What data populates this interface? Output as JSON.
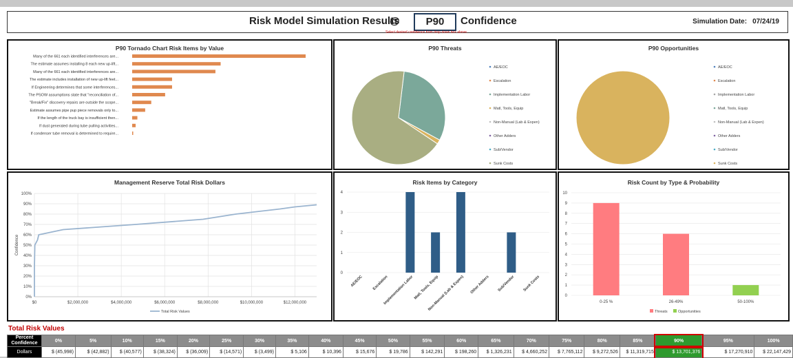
{
  "header": {
    "title": "Risk Model Simulation Results",
    "at": "@",
    "confidence_level": "P90",
    "confidence_label": "Confidence",
    "sim_date_label": "Simulation Date:",
    "sim_date": "07/24/19",
    "hint": "Select desired confidence from drop down box above."
  },
  "colors": {
    "tornado": "#e0894f",
    "teal": "#7ba89a",
    "olive": "#a9ae82",
    "gold": "#d9b35e",
    "line": "#9ab4cf",
    "bar_blue": "#2f5d87",
    "threats": "#ff7c80",
    "opportunities": "#92d050",
    "highlight": "#2e9a2e"
  },
  "chart_data": [
    {
      "type": "bar",
      "orientation": "horizontal",
      "title": "P90 Tornado Chart Risk Items by Value",
      "categories": [
        "Many of the 661 each identified interferences are...",
        "The estimate assumes installing 8 each new up-lift...",
        "Many of the 661 each identified interferences are...",
        "The estimate includes installation of new up-lift feet...",
        "If Engineering determines that some interferences...",
        "The PSOW assumptions state that \"reconciliation of...",
        "\"Break/Fix\" discovery repairs are outside the scope...",
        "Estimate assumes pipe pup piece removals only to...",
        "If the length of the truck bay is insufficient then...",
        "If dust generated during tube pulling activities...",
        "If condenser tube removal is determined to require..."
      ],
      "values": [
        100,
        51,
        48,
        23,
        23,
        19,
        11,
        7.5,
        3,
        2,
        0.5
      ]
    },
    {
      "type": "pie",
      "title": "P90 Threats",
      "labels": [
        "AE/EOC",
        "Escalation",
        "Implementation Labor",
        "Matl, Tools, Equip",
        "Non-Manual (Lab & Expen)",
        "Other Adders",
        "Sub/Vendor",
        "Sunk Costs"
      ],
      "values": [
        0,
        0,
        31,
        1.5,
        0,
        0,
        0,
        67.5
      ]
    },
    {
      "type": "pie",
      "title": "P90 Opportunities",
      "labels": [
        "AE/EOC",
        "Escalation",
        "Implementation Labor",
        "Matl, Tools, Equip",
        "Non-Manual (Lab & Expen)",
        "Other Adders",
        "Sub/Vendor",
        "Sunk Costs"
      ],
      "values": [
        0,
        0,
        0,
        0,
        0,
        0,
        0,
        100
      ]
    },
    {
      "type": "line",
      "title": "Management Reserve Total Risk Dollars",
      "ylabel": "Confidence",
      "series_name": "Total Risk Values",
      "x": [
        -45998,
        -42882,
        -40577,
        -38324,
        -36009,
        -14571,
        -3499,
        5106,
        10396,
        15676,
        19786,
        142291,
        198260,
        1326231,
        4660252,
        7765112,
        9272526,
        11319715,
        12000000,
        13000000
      ],
      "y": [
        0.0,
        0.05,
        0.1,
        0.15,
        0.2,
        0.25,
        0.3,
        0.35,
        0.4,
        0.45,
        0.5,
        0.55,
        0.6,
        0.65,
        0.7,
        0.75,
        0.8,
        0.85,
        0.87,
        0.89
      ],
      "xticks": [
        "$0",
        "$2,000,000",
        "$4,000,000",
        "$6,000,000",
        "$8,000,000",
        "$10,000,000",
        "$12,000,000"
      ],
      "xtick_values": [
        0,
        2000000,
        4000000,
        6000000,
        8000000,
        10000000,
        12000000
      ],
      "yticks": [
        "0%",
        "10%",
        "20%",
        "30%",
        "40%",
        "50%",
        "60%",
        "70%",
        "80%",
        "90%",
        "100%"
      ],
      "xlim": [
        0,
        13000000
      ],
      "ylim": [
        0,
        1
      ],
      "grid": true
    },
    {
      "type": "bar",
      "title": "Risk Items by Category",
      "categories": [
        "AE/EOC",
        "Escalation",
        "Implementation Labor",
        "Matl, Tools, Equip",
        "Non-Manual (Lab & Expen)",
        "Other Adders",
        "Sub/Vendor",
        "Sunk Costs"
      ],
      "values": [
        0,
        0,
        4,
        2,
        4,
        0,
        2,
        0
      ],
      "yticks": [
        "0",
        "1",
        "2",
        "3",
        "4"
      ],
      "ylim": [
        0,
        4
      ]
    },
    {
      "type": "bar",
      "title": "Risk Count by Type & Probability",
      "categories": [
        "0-25 %",
        "26-49%",
        "50-100%"
      ],
      "series": [
        {
          "name": "Threats",
          "values": [
            9,
            6,
            0
          ]
        },
        {
          "name": "Opportunities",
          "values": [
            0,
            0,
            1
          ]
        }
      ],
      "yticks": [
        "0",
        "1",
        "2",
        "3",
        "4",
        "5",
        "6",
        "7",
        "8",
        "9",
        "10"
      ],
      "ylim": [
        0,
        10
      ],
      "legend": "bottom"
    }
  ],
  "total_risk": {
    "title": "Total Risk Values",
    "row_label_1": "Percent",
    "row_label_2": "Confidence",
    "dollars_label": "Dollars",
    "percents": [
      "0%",
      "5%",
      "10%",
      "15%",
      "20%",
      "25%",
      "30%",
      "35%",
      "40%",
      "45%",
      "50%",
      "55%",
      "60%",
      "65%",
      "70%",
      "75%",
      "80%",
      "85%",
      "90%",
      "95%",
      "100%"
    ],
    "dollars": [
      "$ (45,998)",
      "$ (42,882)",
      "$ (40,577)",
      "$ (38,324)",
      "$ (36,009)",
      "$ (14,571)",
      "$ (3,499)",
      "$ 5,106",
      "$ 10,396",
      "$ 15,676",
      "$ 19,786",
      "$ 142,291",
      "$ 198,260",
      "$ 1,326,231",
      "$ 4,660,252",
      "$ 7,765,112",
      "$ 9,272,526",
      "$ 11,319,715",
      "$ 13,701,376",
      "$ 17,270,910",
      "$ 22,147,429"
    ],
    "highlight_index": 18
  }
}
